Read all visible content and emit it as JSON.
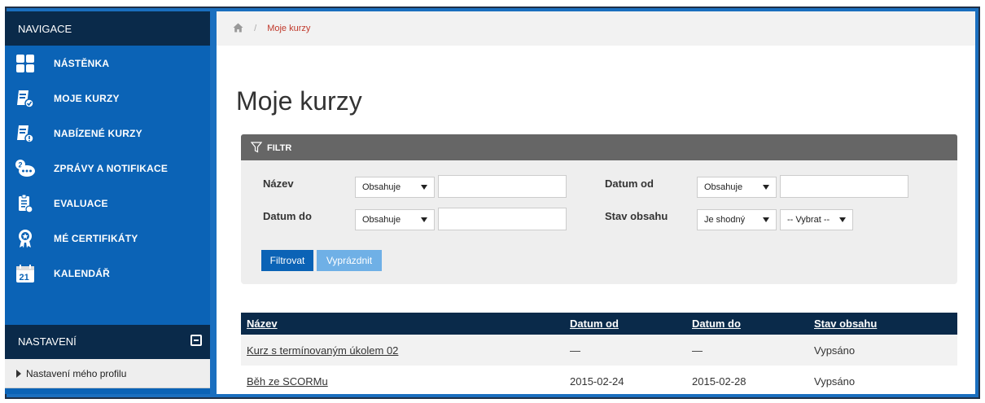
{
  "sidebar": {
    "nav_title": "NAVIGACE",
    "items": [
      {
        "label": "NÁSTĚNKA",
        "icon": "dashboard-grid-icon"
      },
      {
        "label": "MOJE KURZY",
        "icon": "my-courses-icon"
      },
      {
        "label": "NABÍZENÉ KURZY",
        "icon": "offered-courses-icon"
      },
      {
        "label": "ZPRÁVY A NOTIFIKACE",
        "icon": "messages-icon"
      },
      {
        "label": "EVALUACE",
        "icon": "evaluation-icon"
      },
      {
        "label": "MÉ CERTIFIKÁTY",
        "icon": "certificate-icon"
      },
      {
        "label": "KALENDÁŘ",
        "icon": "calendar-icon",
        "day": "21"
      }
    ],
    "settings_title": "NASTAVENÍ",
    "settings_items": [
      {
        "label": "Nastavení mého profilu"
      }
    ]
  },
  "breadcrumb": {
    "current": "Moje kurzy"
  },
  "page_title": "Moje kurzy",
  "filter": {
    "title": "FILTR",
    "fields": {
      "nazev": {
        "label": "Název",
        "operator": "Obsahuje",
        "value": ""
      },
      "datum_od": {
        "label": "Datum od",
        "operator": "Obsahuje",
        "value": ""
      },
      "datum_do": {
        "label": "Datum do",
        "operator": "Obsahuje",
        "value": ""
      },
      "stav_obsahu": {
        "label": "Stav obsahu",
        "operator": "Je shodný",
        "choice": "-- Vybrat --"
      }
    },
    "apply_label": "Filtrovat",
    "clear_label": "Vyprázdnit"
  },
  "table": {
    "columns": [
      "Název",
      "Datum od",
      "Datum do",
      "Stav obsahu"
    ],
    "rows": [
      {
        "name": "Kurz s termínovaným úkolem 02",
        "date_from": "—",
        "date_to": "—",
        "status": "Vypsáno"
      },
      {
        "name": "Běh ze SCORMu",
        "date_from": "2015-02-24",
        "date_to": "2015-02-28",
        "status": "Vypsáno"
      }
    ]
  },
  "colors": {
    "sidebar_blue": "#0b63b6",
    "navy": "#0a2a4a",
    "filter_header": "#666666",
    "breadcrumb_current": "#c0392b",
    "button_primary": "#0b63b6",
    "button_secondary": "#6fb0e6"
  }
}
